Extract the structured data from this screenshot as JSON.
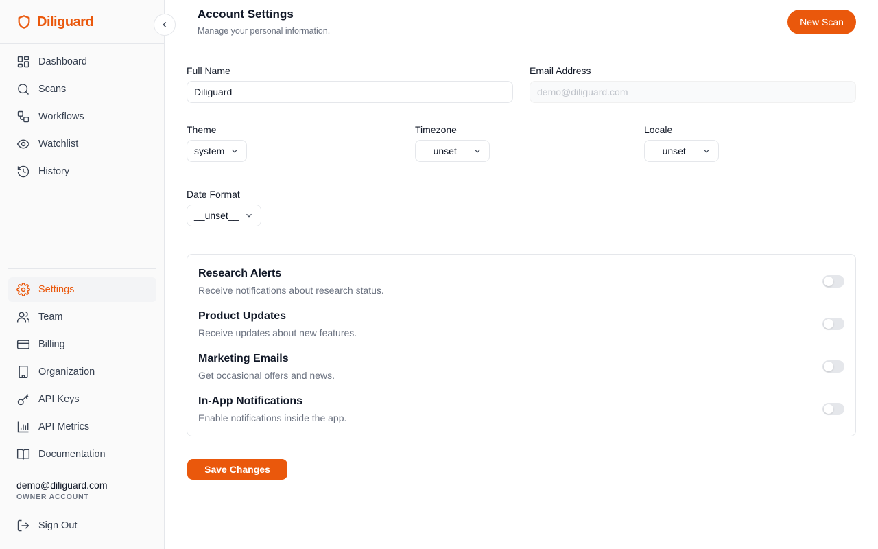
{
  "brand": {
    "name": "Diliguard",
    "accent": "#ea580c"
  },
  "sidebar": {
    "nav": [
      {
        "label": "Dashboard",
        "icon": "dashboard-icon"
      },
      {
        "label": "Scans",
        "icon": "search-icon"
      },
      {
        "label": "Workflows",
        "icon": "workflow-icon"
      },
      {
        "label": "Watchlist",
        "icon": "eye-icon"
      },
      {
        "label": "History",
        "icon": "history-icon"
      }
    ],
    "secondary": [
      {
        "label": "Settings",
        "icon": "gear-icon",
        "active": true
      },
      {
        "label": "Team",
        "icon": "users-icon"
      },
      {
        "label": "Billing",
        "icon": "credit-card-icon"
      },
      {
        "label": "Organization",
        "icon": "building-icon"
      },
      {
        "label": "API Keys",
        "icon": "key-icon"
      },
      {
        "label": "API Metrics",
        "icon": "bar-chart-icon"
      },
      {
        "label": "Documentation",
        "icon": "book-icon"
      }
    ],
    "user": {
      "email": "demo@diliguard.com",
      "role": "OWNER ACCOUNT"
    },
    "sign_out": "Sign Out"
  },
  "header": {
    "title": "Account Settings",
    "subtitle": "Manage your personal information.",
    "new_scan": "New Scan"
  },
  "form": {
    "full_name": {
      "label": "Full Name",
      "value": "Diliguard"
    },
    "email": {
      "label": "Email Address",
      "placeholder": "demo@diliguard.com"
    },
    "theme": {
      "label": "Theme",
      "value": "system"
    },
    "timezone": {
      "label": "Timezone",
      "value": "__unset__"
    },
    "locale": {
      "label": "Locale",
      "value": "__unset__"
    },
    "date_format": {
      "label": "Date Format",
      "value": "__unset__"
    }
  },
  "notifications": [
    {
      "title": "Research Alerts",
      "description": "Receive notifications about research status.",
      "enabled": false
    },
    {
      "title": "Product Updates",
      "description": "Receive updates about new features.",
      "enabled": false
    },
    {
      "title": "Marketing Emails",
      "description": "Get occasional offers and news.",
      "enabled": false
    },
    {
      "title": "In-App Notifications",
      "description": "Enable notifications inside the app.",
      "enabled": false
    }
  ],
  "save_label": "Save Changes"
}
